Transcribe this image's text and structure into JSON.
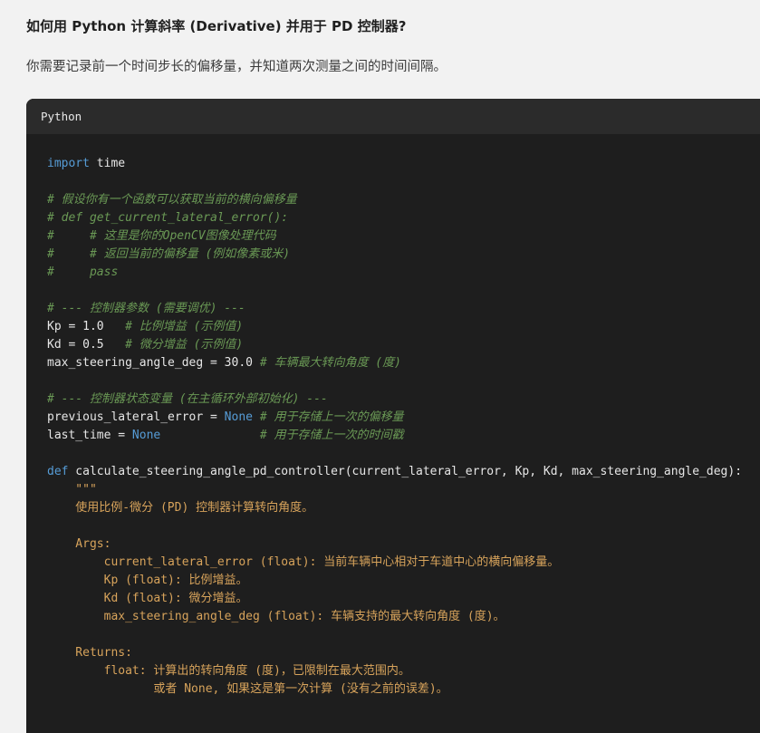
{
  "heading": "如何用 Python 计算斜率 (Derivative) 并用于 PD 控制器?",
  "intro": "你需要记录前一个时间步长的偏移量，并知道两次测量之间的时间间隔。",
  "code_block": {
    "language": "Python",
    "lines": [
      {
        "segments": [
          {
            "t": "import",
            "c": "kw"
          },
          {
            "t": " time",
            "c": ""
          }
        ]
      },
      {
        "segments": []
      },
      {
        "segments": [
          {
            "t": "# 假设你有一个函数可以获取当前的横向偏移量",
            "c": "cmt"
          }
        ]
      },
      {
        "segments": [
          {
            "t": "# def get_current_lateral_error():",
            "c": "cmt"
          }
        ]
      },
      {
        "segments": [
          {
            "t": "#     # 这里是你的OpenCV图像处理代码",
            "c": "cmt"
          }
        ]
      },
      {
        "segments": [
          {
            "t": "#     # 返回当前的偏移量 (例如像素或米)",
            "c": "cmt"
          }
        ]
      },
      {
        "segments": [
          {
            "t": "#     pass",
            "c": "cmt"
          }
        ]
      },
      {
        "segments": []
      },
      {
        "segments": [
          {
            "t": "# --- 控制器参数 (需要调优) ---",
            "c": "cmt"
          }
        ]
      },
      {
        "segments": [
          {
            "t": "Kp = 1.0   ",
            "c": ""
          },
          {
            "t": "# 比例增益 (示例值)",
            "c": "cmt"
          }
        ]
      },
      {
        "segments": [
          {
            "t": "Kd = 0.5   ",
            "c": ""
          },
          {
            "t": "# 微分增益 (示例值)",
            "c": "cmt"
          }
        ]
      },
      {
        "segments": [
          {
            "t": "max_steering_angle_deg = 30.0 ",
            "c": ""
          },
          {
            "t": "# 车辆最大转向角度 (度)",
            "c": "cmt"
          }
        ]
      },
      {
        "segments": []
      },
      {
        "segments": [
          {
            "t": "# --- 控制器状态变量 (在主循环外部初始化) ---",
            "c": "cmt"
          }
        ]
      },
      {
        "segments": [
          {
            "t": "previous_lateral_error = ",
            "c": ""
          },
          {
            "t": "None",
            "c": "none"
          },
          {
            "t": " ",
            "c": ""
          },
          {
            "t": "# 用于存储上一次的偏移量",
            "c": "cmt"
          }
        ]
      },
      {
        "segments": [
          {
            "t": "last_time = ",
            "c": ""
          },
          {
            "t": "None",
            "c": "none"
          },
          {
            "t": "              ",
            "c": ""
          },
          {
            "t": "# 用于存储上一次的时间戳",
            "c": "cmt"
          }
        ]
      },
      {
        "segments": []
      },
      {
        "segments": [
          {
            "t": "def",
            "c": "kw"
          },
          {
            "t": " calculate_steering_angle_pd_controller(current_lateral_error, Kp, Kd, max_steering_angle_deg):",
            "c": ""
          }
        ]
      },
      {
        "segments": [
          {
            "t": "    \"\"\"",
            "c": "doc"
          }
        ]
      },
      {
        "segments": [
          {
            "t": "    使用比例-微分 (PD) 控制器计算转向角度。",
            "c": "doc"
          }
        ]
      },
      {
        "segments": []
      },
      {
        "segments": [
          {
            "t": "    Args:",
            "c": "doc"
          }
        ]
      },
      {
        "segments": [
          {
            "t": "        current_lateral_error (float): 当前车辆中心相对于车道中心的横向偏移量。",
            "c": "doc"
          }
        ]
      },
      {
        "segments": [
          {
            "t": "        Kp (float): 比例增益。",
            "c": "doc"
          }
        ]
      },
      {
        "segments": [
          {
            "t": "        Kd (float): 微分增益。",
            "c": "doc"
          }
        ]
      },
      {
        "segments": [
          {
            "t": "        max_steering_angle_deg (float): 车辆支持的最大转向角度 (度)。",
            "c": "doc"
          }
        ]
      },
      {
        "segments": []
      },
      {
        "segments": [
          {
            "t": "    Returns:",
            "c": "doc"
          }
        ]
      },
      {
        "segments": [
          {
            "t": "        float: 计算出的转向角度 (度)，已限制在最大范围内。",
            "c": "doc"
          }
        ]
      },
      {
        "segments": [
          {
            "t": "               或者 None, 如果这是第一次计算 (没有之前的误差)。",
            "c": "doc"
          }
        ]
      }
    ]
  }
}
